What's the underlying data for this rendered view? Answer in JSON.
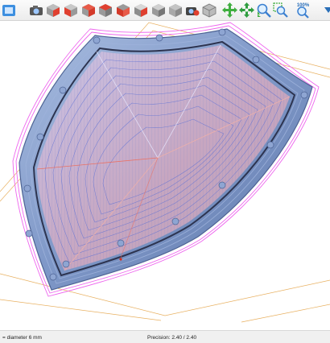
{
  "toolbar": {
    "zoom_label": "100%",
    "buttons": [
      {
        "name": "app-tab-icon"
      },
      {
        "name": "camera-view-icon"
      },
      {
        "name": "view-iso-red-icon"
      },
      {
        "name": "view-front-red-icon"
      },
      {
        "name": "view-right-red-icon"
      },
      {
        "name": "view-top-red-icon"
      },
      {
        "name": "view-back-red-icon"
      },
      {
        "name": "view-left-red-icon"
      },
      {
        "name": "view-bottom-grey-icon"
      },
      {
        "name": "view-cube-grey-icon"
      },
      {
        "name": "camera-red-icon"
      },
      {
        "name": "render-mode-icon"
      },
      {
        "name": "pan-green-icon"
      },
      {
        "name": "move-green-icon"
      },
      {
        "name": "zoom-in-icon"
      },
      {
        "name": "zoom-window-icon"
      },
      {
        "name": "zoom-100-icon"
      },
      {
        "name": "more-icon"
      }
    ]
  },
  "colors": {
    "shield_fill": "#8da4cf",
    "shield_edge": "#5f79ad",
    "toolpath_pink": "#ee66ee",
    "toolpath_blue": "#5a6fd6",
    "stock_outline": "#e8b060"
  },
  "status": {
    "tool": "= diameter 6 mm",
    "precision": "Precision: 2.40 / 2.40"
  }
}
